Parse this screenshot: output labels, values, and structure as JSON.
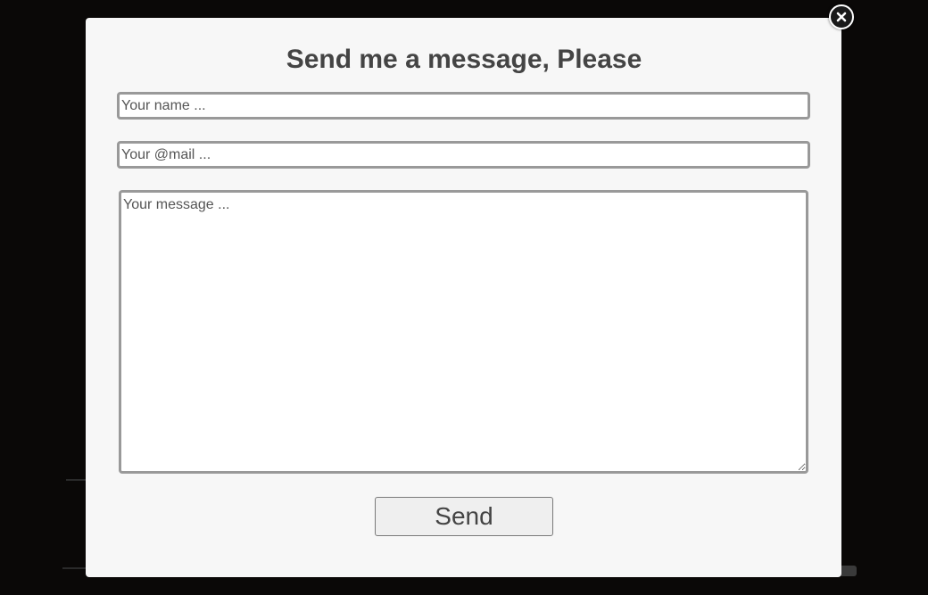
{
  "colors": {
    "backdrop": "#0a0807",
    "modal_background": "#f7f7f7",
    "field_border": "#999999",
    "text": "#444444"
  },
  "modal": {
    "title": "Send me a message, Please",
    "close_icon": "close-icon",
    "fields": {
      "name_placeholder": "Your name ...",
      "email_placeholder": "Your @mail ...",
      "message_placeholder": "Your message ..."
    },
    "send_label": "Send"
  }
}
